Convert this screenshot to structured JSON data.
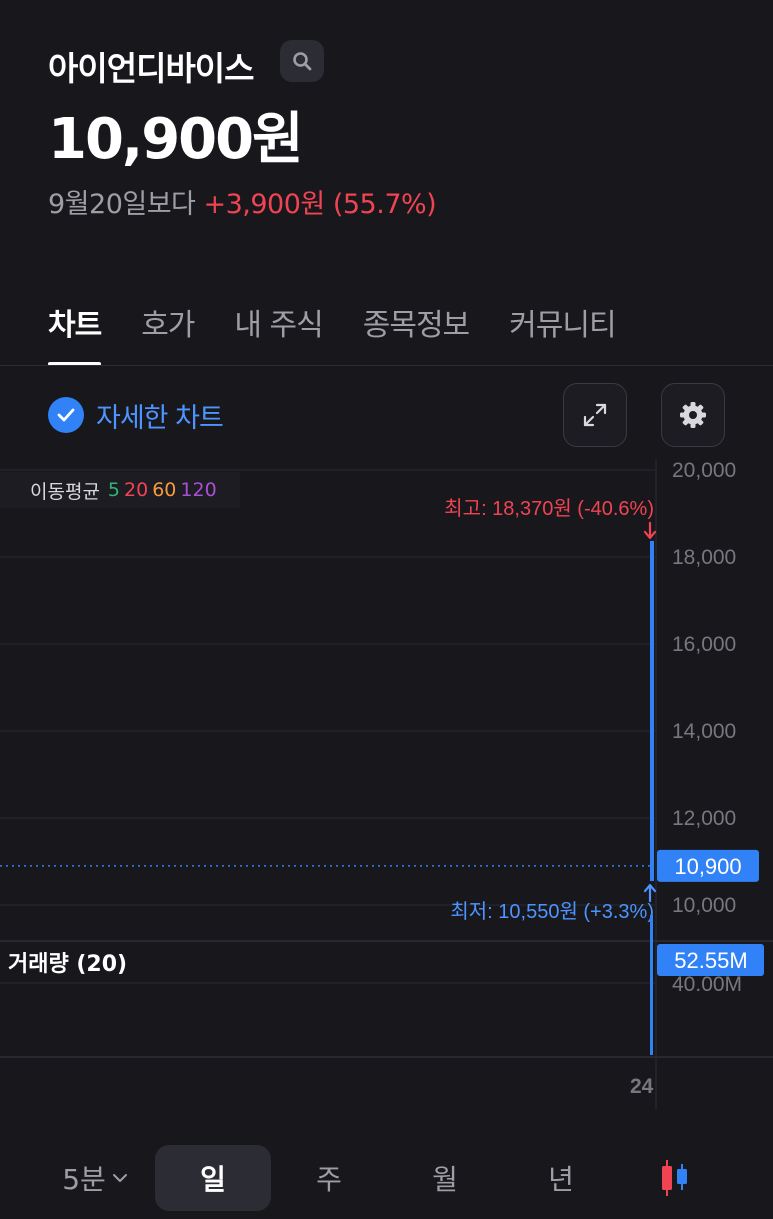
{
  "stock": {
    "name": "아이언디바이스",
    "price": "10,900원",
    "change_base": "9월20일보다",
    "change_value": "+3,900원 (55.7%)"
  },
  "tabs": [
    "차트",
    "호가",
    "내 주식",
    "종목정보",
    "커뮤니티"
  ],
  "detail_chart_label": "자세한 차트",
  "moving_average": {
    "label": "이동평균",
    "periods": [
      {
        "value": "5",
        "color": "#2fb574"
      },
      {
        "value": "20",
        "color": "#f04452"
      },
      {
        "value": "60",
        "color": "#f79a3a"
      },
      {
        "value": "120",
        "color": "#a94fd6"
      }
    ]
  },
  "chart_data": {
    "type": "candlestick",
    "price_axis": {
      "ticks": [
        "20,000",
        "18,000",
        "16,000",
        "14,000",
        "12,000",
        "10,000"
      ],
      "range": [
        9600,
        20000
      ]
    },
    "candle": {
      "open": 18370,
      "high": 18370,
      "low": 10550,
      "close": 10900,
      "color": "#3182f6"
    },
    "current_price_label": "10,900",
    "high_annotation": "최고: 18,370원 (-40.6%)",
    "low_annotation": "최저: 10,550원 (+3.3%)",
    "volume_panel": {
      "title": "거래량 (20)",
      "tick": "40.00M",
      "current_label": "52.55M",
      "volume": 52.55,
      "range": [
        0,
        60
      ]
    },
    "x_tick": "24"
  },
  "timeframes": {
    "minute": "5분",
    "items": [
      "일",
      "주",
      "월",
      "년"
    ],
    "active": "일"
  },
  "colors": {
    "background": "#17171c",
    "accent": "#3182f6",
    "up": "#f04452",
    "down": "#3182f6"
  }
}
